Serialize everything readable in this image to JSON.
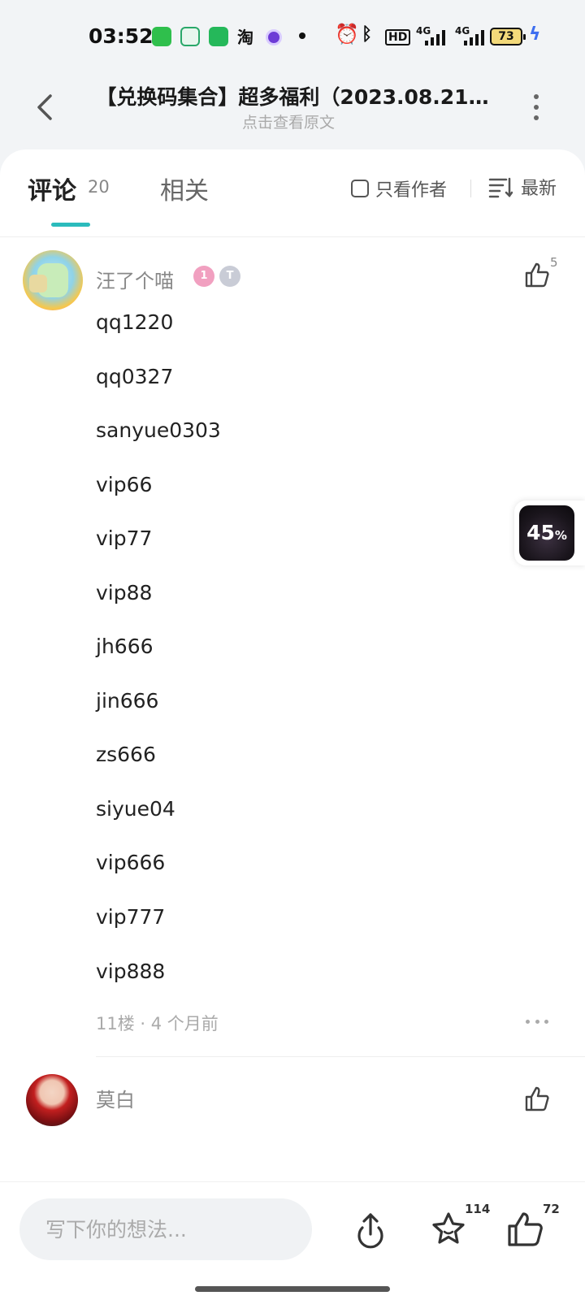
{
  "status_bar": {
    "time": "03:52",
    "app_icons": [
      "app-grid-icon",
      "home-app-icon",
      "chat-app-icon",
      "taobao-icon",
      "media-app-icon"
    ],
    "taobao_label": "淘",
    "hd_label": "HD",
    "signal1_label": "4G",
    "signal2_label": "4G",
    "battery": "73"
  },
  "header": {
    "title": "【兑换码集合】超多福利（2023.08.21…",
    "subtitle": "点击查看原文"
  },
  "tabs": {
    "comments_label": "评论",
    "comments_count": "20",
    "related_label": "相关",
    "author_only_label": "只看作者",
    "sort_label": "最新"
  },
  "comments": [
    {
      "username": "汪了个喵",
      "badge_level": "1",
      "badge_t": "T",
      "likes": "5",
      "codes": [
        "qq1220",
        "qq0327",
        "sanyue0303",
        "vip66",
        "vip77",
        "vip88",
        "jh666",
        "jin666",
        "zs666",
        "siyue04",
        "vip666",
        "vip777",
        "vip888"
      ],
      "meta": "11楼 · 4 个月前"
    },
    {
      "username": "莫白"
    }
  ],
  "float_badge": {
    "value": "45",
    "unit": "%"
  },
  "bottom_bar": {
    "input_placeholder": "写下你的想法...",
    "favorites_count": "114",
    "likes_count": "72"
  },
  "colors": {
    "accent": "#2bbbbc",
    "background": "#f2f4f6"
  }
}
